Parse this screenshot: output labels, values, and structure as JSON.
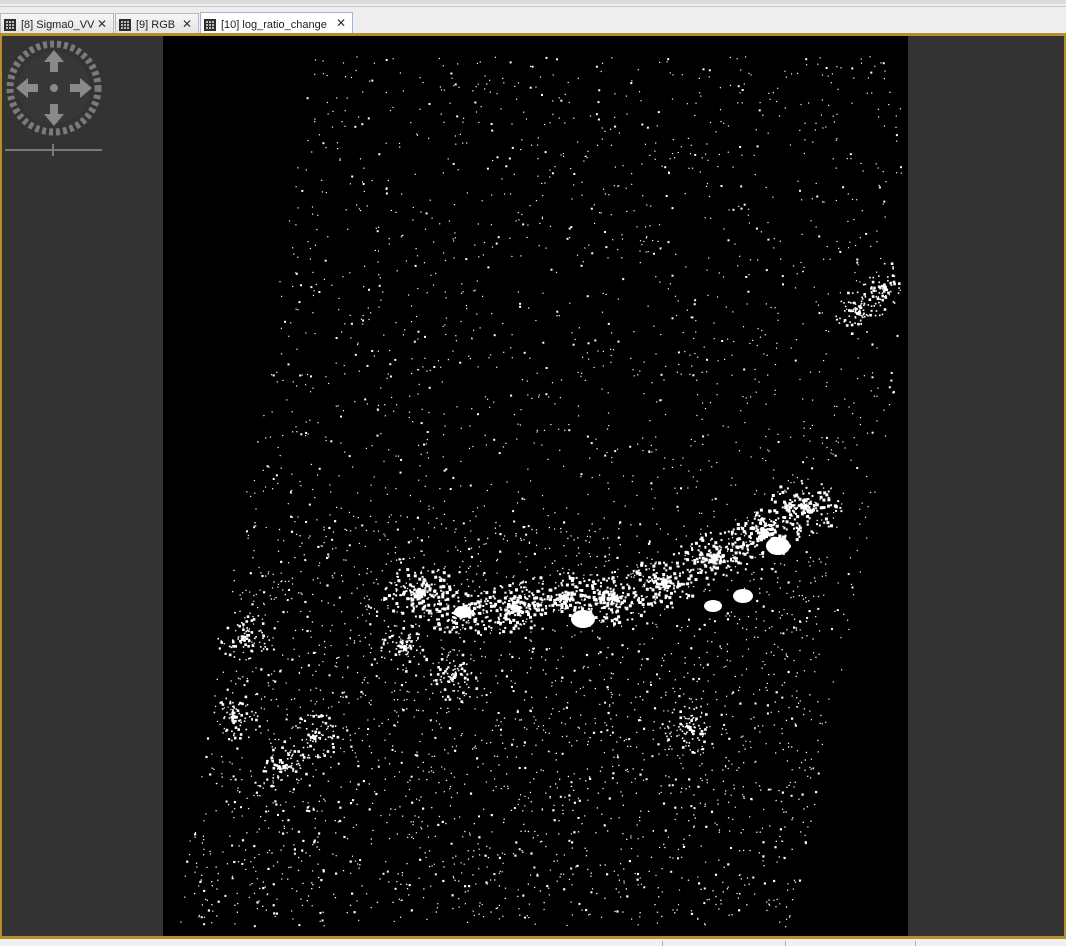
{
  "tabs": [
    {
      "label": "[8] Sigma0_VV",
      "icon": "raster-band-icon",
      "active": false
    },
    {
      "label": "[9] RGB",
      "icon": "raster-band-icon",
      "active": false
    },
    {
      "label": "[10] log_ratio_change",
      "icon": "raster-band-icon",
      "active": true
    }
  ],
  "tab_close_glyph": "✕",
  "viewer": {
    "background": "#333333",
    "image_background": "#000000",
    "border_color": "#b58f2a",
    "pixel_color": "#ffffff"
  },
  "navigation": {
    "pan_control_icon": "navigation-wheel-icon",
    "zoom_slider_icon": "zoom-slider-icon"
  }
}
